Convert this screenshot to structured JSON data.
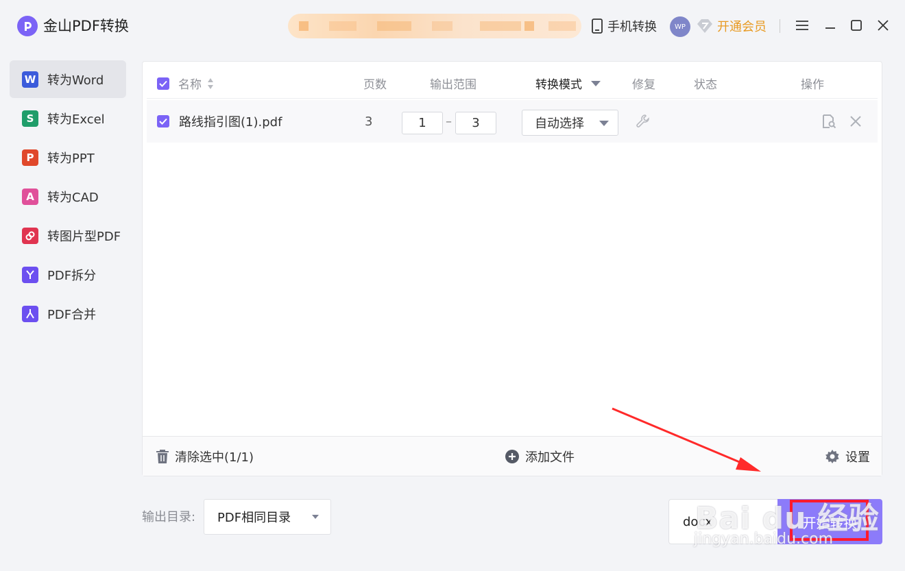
{
  "app": {
    "title": "金山PDF转换"
  },
  "titlebar": {
    "phone_convert": "手机转换",
    "avatar_text": "WP",
    "vip": "开通会员"
  },
  "sidebar": {
    "items": [
      {
        "label": "转为Word",
        "icon": "W",
        "color": "#3b5bdb"
      },
      {
        "label": "转为Excel",
        "icon": "S",
        "color": "#1f9d6a"
      },
      {
        "label": "转为PPT",
        "icon": "P",
        "color": "#e0482b"
      },
      {
        "label": "转为CAD",
        "icon": "A",
        "color": "#e0509a"
      },
      {
        "label": "转图片型PDF",
        "icon": "image-pdf-icon",
        "color": "#e03450"
      },
      {
        "label": "PDF拆分",
        "icon": "split-icon",
        "color": "#6c4ff0"
      },
      {
        "label": "PDF合并",
        "icon": "merge-icon",
        "color": "#6c4ff0"
      }
    ]
  },
  "table": {
    "columns": {
      "name": "名称",
      "pages": "页数",
      "range": "输出范围",
      "mode": "转换模式",
      "repair": "修复",
      "status": "状态",
      "action": "操作"
    },
    "rows": [
      {
        "name": "路线指引图(1).pdf",
        "pages": "3",
        "range_from": "1",
        "range_to": "3",
        "mode": "自动选择"
      }
    ]
  },
  "footer": {
    "clear": "清除选中(1/1)",
    "add": "添加文件",
    "settings": "设置"
  },
  "bottom": {
    "output_label": "输出目录:",
    "output_value": "PDF相同目录",
    "format": "docx",
    "start": "开始转换"
  },
  "watermark": {
    "main": "Bai du 经验",
    "sub": "jingyan.baidu.com"
  },
  "colors": {
    "accent": "#7b63f6",
    "button": "#8c7bfa",
    "vip": "#e89a22",
    "annotation": "#ff1a2d"
  }
}
